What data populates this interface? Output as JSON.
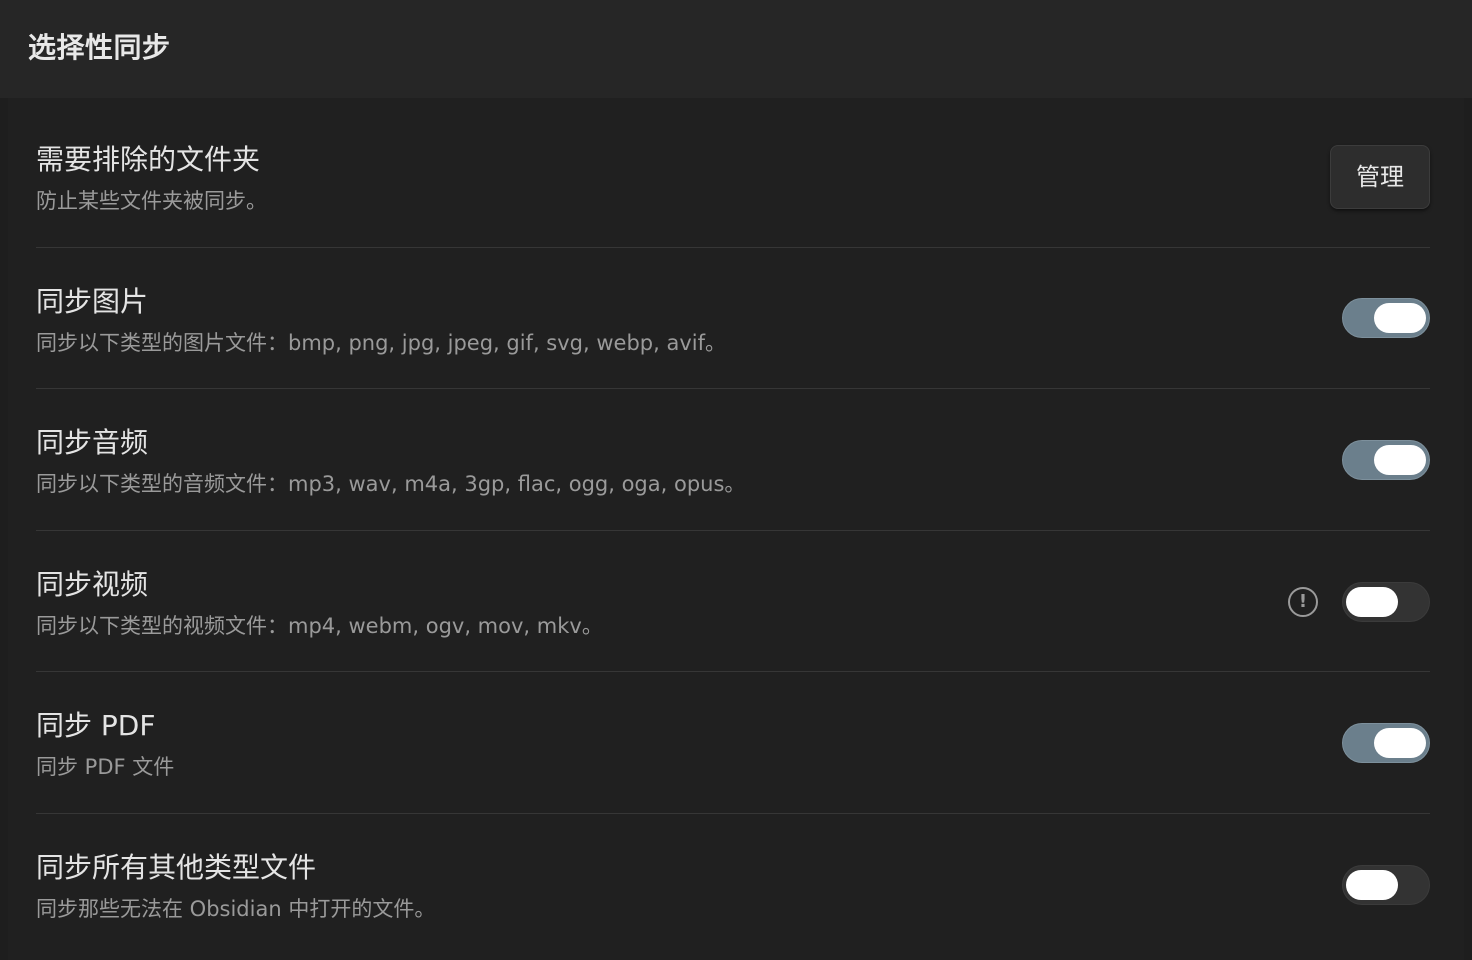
{
  "header": {
    "title": "选择性同步"
  },
  "settings": [
    {
      "title": "需要排除的文件夹",
      "description": "防止某些文件夹被同步。",
      "button_label": "管理"
    },
    {
      "title": "同步图片",
      "description": "同步以下类型的图片文件：bmp, png, jpg, jpeg, gif, svg, webp, avif。",
      "enabled": true
    },
    {
      "title": "同步音频",
      "description": "同步以下类型的音频文件：mp3, wav, m4a, 3gp, flac, ogg, oga, opus。",
      "enabled": true
    },
    {
      "title": "同步视频",
      "description": "同步以下类型的视频文件：mp4, webm, ogv, mov, mkv。",
      "enabled": false,
      "info_icon": "alert-circle-icon",
      "info_glyph": "!"
    },
    {
      "title": "同步 PDF",
      "description": "同步 PDF 文件",
      "enabled": true
    },
    {
      "title": "同步所有其他类型文件",
      "description": "同步那些无法在 Obsidian 中打开的文件。",
      "enabled": false
    }
  ],
  "colors": {
    "background": "#1e1e1e",
    "toggle_on": "#6b7f8c",
    "toggle_off": "#333333"
  }
}
